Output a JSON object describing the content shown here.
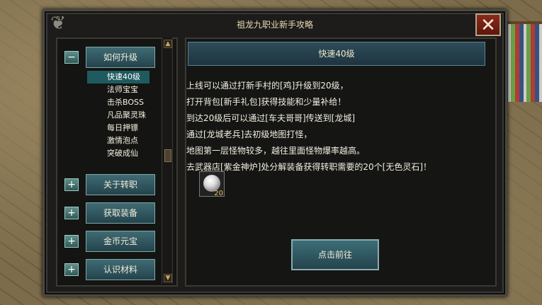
{
  "dialog": {
    "title": "祖龙九职业新手攻略",
    "close_glyph": "✕"
  },
  "nav": {
    "categories": [
      {
        "toggle": "−",
        "label": "如何升级"
      },
      {
        "toggle": "+",
        "label": "关于转职"
      },
      {
        "toggle": "+",
        "label": "获取装备"
      },
      {
        "toggle": "+",
        "label": "金币元宝"
      },
      {
        "toggle": "+",
        "label": "认识材料"
      }
    ],
    "sub_items": [
      "快速40级",
      "法师宝宝",
      "击杀BOSS",
      "凡品聚灵珠",
      "每日押镖",
      "激情泡点",
      "突破成仙"
    ],
    "scroll_up": "▲",
    "scroll_down": "▼"
  },
  "content": {
    "header": "快速40级",
    "lines": [
      "上线可以通过打新手村的[鸡]升级到20级，",
      "打开背包[新手礼包]获得技能和少量补给！",
      "到达20级后可以通过[车夫哥哥]传送到[龙城]",
      "通过[龙城老兵]去初级地图打怪，",
      "地图第一层怪物较多，越往里面怪物爆率越高。",
      "去武器店[紫金神炉]处分解装备获得转职需要的20个[无色灵石]！"
    ],
    "item": {
      "icon": "spirit-stone-icon",
      "quantity": "20"
    },
    "go_button": "点击前往"
  },
  "colors": {
    "accent": "#3f6b74",
    "close": "#8a2a1a",
    "active_item": "#1e5a5e"
  }
}
